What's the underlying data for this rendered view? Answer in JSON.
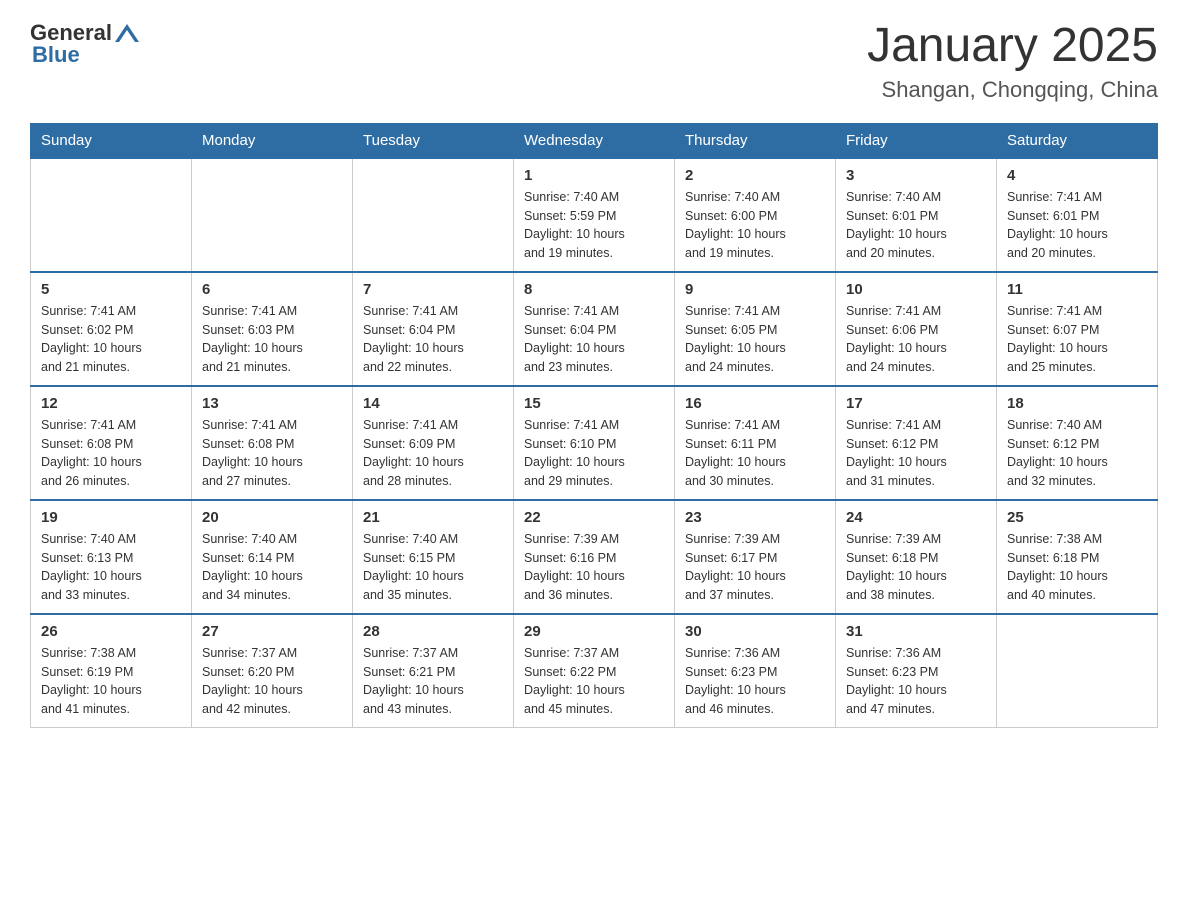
{
  "header": {
    "logo_general": "General",
    "logo_blue": "Blue",
    "month_title": "January 2025",
    "location": "Shangan, Chongqing, China"
  },
  "weekdays": [
    "Sunday",
    "Monday",
    "Tuesday",
    "Wednesday",
    "Thursday",
    "Friday",
    "Saturday"
  ],
  "weeks": [
    [
      {
        "day": "",
        "info": ""
      },
      {
        "day": "",
        "info": ""
      },
      {
        "day": "",
        "info": ""
      },
      {
        "day": "1",
        "info": "Sunrise: 7:40 AM\nSunset: 5:59 PM\nDaylight: 10 hours\nand 19 minutes."
      },
      {
        "day": "2",
        "info": "Sunrise: 7:40 AM\nSunset: 6:00 PM\nDaylight: 10 hours\nand 19 minutes."
      },
      {
        "day": "3",
        "info": "Sunrise: 7:40 AM\nSunset: 6:01 PM\nDaylight: 10 hours\nand 20 minutes."
      },
      {
        "day": "4",
        "info": "Sunrise: 7:41 AM\nSunset: 6:01 PM\nDaylight: 10 hours\nand 20 minutes."
      }
    ],
    [
      {
        "day": "5",
        "info": "Sunrise: 7:41 AM\nSunset: 6:02 PM\nDaylight: 10 hours\nand 21 minutes."
      },
      {
        "day": "6",
        "info": "Sunrise: 7:41 AM\nSunset: 6:03 PM\nDaylight: 10 hours\nand 21 minutes."
      },
      {
        "day": "7",
        "info": "Sunrise: 7:41 AM\nSunset: 6:04 PM\nDaylight: 10 hours\nand 22 minutes."
      },
      {
        "day": "8",
        "info": "Sunrise: 7:41 AM\nSunset: 6:04 PM\nDaylight: 10 hours\nand 23 minutes."
      },
      {
        "day": "9",
        "info": "Sunrise: 7:41 AM\nSunset: 6:05 PM\nDaylight: 10 hours\nand 24 minutes."
      },
      {
        "day": "10",
        "info": "Sunrise: 7:41 AM\nSunset: 6:06 PM\nDaylight: 10 hours\nand 24 minutes."
      },
      {
        "day": "11",
        "info": "Sunrise: 7:41 AM\nSunset: 6:07 PM\nDaylight: 10 hours\nand 25 minutes."
      }
    ],
    [
      {
        "day": "12",
        "info": "Sunrise: 7:41 AM\nSunset: 6:08 PM\nDaylight: 10 hours\nand 26 minutes."
      },
      {
        "day": "13",
        "info": "Sunrise: 7:41 AM\nSunset: 6:08 PM\nDaylight: 10 hours\nand 27 minutes."
      },
      {
        "day": "14",
        "info": "Sunrise: 7:41 AM\nSunset: 6:09 PM\nDaylight: 10 hours\nand 28 minutes."
      },
      {
        "day": "15",
        "info": "Sunrise: 7:41 AM\nSunset: 6:10 PM\nDaylight: 10 hours\nand 29 minutes."
      },
      {
        "day": "16",
        "info": "Sunrise: 7:41 AM\nSunset: 6:11 PM\nDaylight: 10 hours\nand 30 minutes."
      },
      {
        "day": "17",
        "info": "Sunrise: 7:41 AM\nSunset: 6:12 PM\nDaylight: 10 hours\nand 31 minutes."
      },
      {
        "day": "18",
        "info": "Sunrise: 7:40 AM\nSunset: 6:12 PM\nDaylight: 10 hours\nand 32 minutes."
      }
    ],
    [
      {
        "day": "19",
        "info": "Sunrise: 7:40 AM\nSunset: 6:13 PM\nDaylight: 10 hours\nand 33 minutes."
      },
      {
        "day": "20",
        "info": "Sunrise: 7:40 AM\nSunset: 6:14 PM\nDaylight: 10 hours\nand 34 minutes."
      },
      {
        "day": "21",
        "info": "Sunrise: 7:40 AM\nSunset: 6:15 PM\nDaylight: 10 hours\nand 35 minutes."
      },
      {
        "day": "22",
        "info": "Sunrise: 7:39 AM\nSunset: 6:16 PM\nDaylight: 10 hours\nand 36 minutes."
      },
      {
        "day": "23",
        "info": "Sunrise: 7:39 AM\nSunset: 6:17 PM\nDaylight: 10 hours\nand 37 minutes."
      },
      {
        "day": "24",
        "info": "Sunrise: 7:39 AM\nSunset: 6:18 PM\nDaylight: 10 hours\nand 38 minutes."
      },
      {
        "day": "25",
        "info": "Sunrise: 7:38 AM\nSunset: 6:18 PM\nDaylight: 10 hours\nand 40 minutes."
      }
    ],
    [
      {
        "day": "26",
        "info": "Sunrise: 7:38 AM\nSunset: 6:19 PM\nDaylight: 10 hours\nand 41 minutes."
      },
      {
        "day": "27",
        "info": "Sunrise: 7:37 AM\nSunset: 6:20 PM\nDaylight: 10 hours\nand 42 minutes."
      },
      {
        "day": "28",
        "info": "Sunrise: 7:37 AM\nSunset: 6:21 PM\nDaylight: 10 hours\nand 43 minutes."
      },
      {
        "day": "29",
        "info": "Sunrise: 7:37 AM\nSunset: 6:22 PM\nDaylight: 10 hours\nand 45 minutes."
      },
      {
        "day": "30",
        "info": "Sunrise: 7:36 AM\nSunset: 6:23 PM\nDaylight: 10 hours\nand 46 minutes."
      },
      {
        "day": "31",
        "info": "Sunrise: 7:36 AM\nSunset: 6:23 PM\nDaylight: 10 hours\nand 47 minutes."
      },
      {
        "day": "",
        "info": ""
      }
    ]
  ]
}
